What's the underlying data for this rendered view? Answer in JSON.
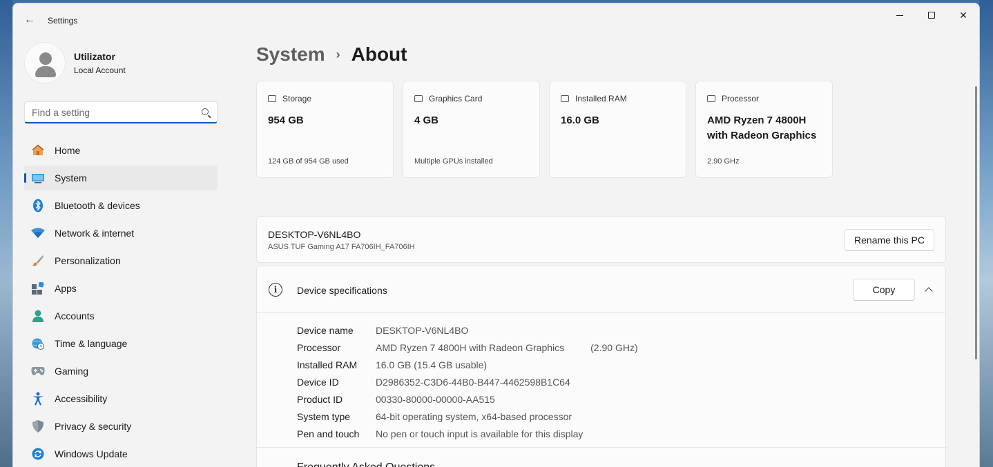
{
  "window": {
    "title": "Settings"
  },
  "profile": {
    "name": "Utilizator",
    "account_type": "Local Account"
  },
  "search": {
    "placeholder": "Find a setting"
  },
  "sidebar": {
    "items": [
      {
        "label": "Home",
        "icon": "home-icon",
        "active": false
      },
      {
        "label": "System",
        "icon": "system-icon",
        "active": true
      },
      {
        "label": "Bluetooth & devices",
        "icon": "bluetooth-icon",
        "active": false
      },
      {
        "label": "Network & internet",
        "icon": "wifi-icon",
        "active": false
      },
      {
        "label": "Personalization",
        "icon": "brush-icon",
        "active": false
      },
      {
        "label": "Apps",
        "icon": "apps-icon",
        "active": false
      },
      {
        "label": "Accounts",
        "icon": "accounts-icon",
        "active": false
      },
      {
        "label": "Time & language",
        "icon": "globe-clock-icon",
        "active": false
      },
      {
        "label": "Gaming",
        "icon": "gamepad-icon",
        "active": false
      },
      {
        "label": "Accessibility",
        "icon": "accessibility-icon",
        "active": false
      },
      {
        "label": "Privacy & security",
        "icon": "shield-icon",
        "active": false
      },
      {
        "label": "Windows Update",
        "icon": "update-icon",
        "active": false
      }
    ]
  },
  "breadcrumb": {
    "parent": "System",
    "current": "About"
  },
  "cards": [
    {
      "title": "Storage",
      "value": "954 GB",
      "sub": "124 GB of 954 GB used",
      "icon": "storage-icon"
    },
    {
      "title": "Graphics Card",
      "value": "4 GB",
      "sub": "Multiple GPUs installed",
      "icon": "graphics-card-icon"
    },
    {
      "title": "Installed RAM",
      "value": "16.0 GB",
      "sub": "",
      "icon": "ram-icon"
    },
    {
      "title": "Processor",
      "value": "AMD Ryzen 7 4800H with Radeon Graphics",
      "sub": "2.90 GHz",
      "icon": "processor-icon"
    }
  ],
  "pc": {
    "name": "DESKTOP-V6NL4BO",
    "model": "ASUS TUF Gaming A17 FA706IH_FA706IH",
    "rename_label": "Rename this PC"
  },
  "device_specs": {
    "title": "Device specifications",
    "copy_label": "Copy",
    "rows": [
      {
        "label": "Device name",
        "value": "DESKTOP-V6NL4BO",
        "extra": ""
      },
      {
        "label": "Processor",
        "value": "AMD Ryzen 7 4800H with Radeon Graphics",
        "extra": "(2.90 GHz)"
      },
      {
        "label": "Installed RAM",
        "value": "16.0 GB (15.4 GB usable)",
        "extra": ""
      },
      {
        "label": "Device ID",
        "value": "D2986352-C3D6-44B0-B447-4462598B1C64",
        "extra": ""
      },
      {
        "label": "Product ID",
        "value": "00330-80000-00000-AA515",
        "extra": ""
      },
      {
        "label": "System type",
        "value": "64-bit operating system, x64-based processor",
        "extra": ""
      },
      {
        "label": "Pen and touch",
        "value": "No pen or touch input is available for this display",
        "extra": ""
      }
    ]
  },
  "faq": {
    "title": "Frequently Asked Questions"
  },
  "colors": {
    "accent": "#005fb8",
    "window_bg": "#f3f3f3",
    "card_bg": "#fbfbfb"
  }
}
